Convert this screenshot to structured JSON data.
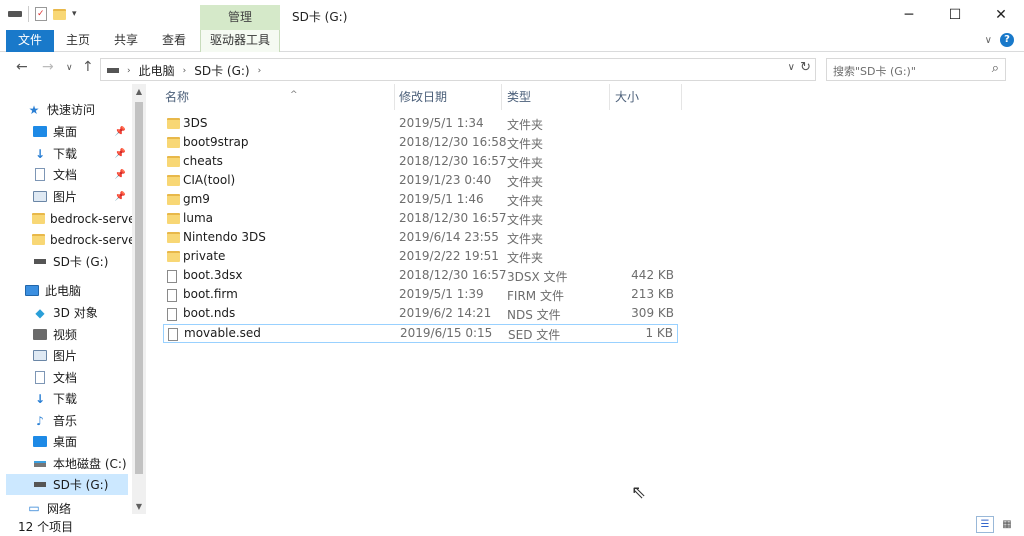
{
  "titlebar": {
    "context_tab": "管理",
    "window_title": "SD卡 (G:)",
    "minimize": "─",
    "maximize": "☐",
    "close": "✕"
  },
  "ribbon": {
    "tabs": [
      "文件",
      "主页",
      "共享",
      "查看",
      "驱动器工具"
    ],
    "expand": "∨",
    "help": "?"
  },
  "address": {
    "crumbs": [
      "此电脑",
      "SD卡 (G:)"
    ],
    "search_placeholder": "搜索\"SD卡 (G:)\""
  },
  "nav": {
    "quick_access": "快速访问",
    "quick_items": [
      "桌面",
      "下载",
      "文档",
      "图片",
      "bedrock-serve",
      "bedrock-serve",
      "SD卡 (G:)"
    ],
    "this_pc": "此电脑",
    "pc_items": [
      "3D 对象",
      "视频",
      "图片",
      "文档",
      "下载",
      "音乐",
      "桌面",
      "本地磁盘 (C:)",
      "SD卡 (G:)"
    ],
    "network": "网络"
  },
  "columns": {
    "name": "名称",
    "date": "修改日期",
    "type": "类型",
    "size": "大小"
  },
  "files": [
    {
      "name": "3DS",
      "date": "2019/5/1 1:34",
      "type": "文件夹",
      "size": "",
      "kind": "folder"
    },
    {
      "name": "boot9strap",
      "date": "2018/12/30 16:58",
      "type": "文件夹",
      "size": "",
      "kind": "folder"
    },
    {
      "name": "cheats",
      "date": "2018/12/30 16:57",
      "type": "文件夹",
      "size": "",
      "kind": "folder"
    },
    {
      "name": "CIA(tool)",
      "date": "2019/1/23 0:40",
      "type": "文件夹",
      "size": "",
      "kind": "folder"
    },
    {
      "name": "gm9",
      "date": "2019/5/1 1:46",
      "type": "文件夹",
      "size": "",
      "kind": "folder"
    },
    {
      "name": "luma",
      "date": "2018/12/30 16:57",
      "type": "文件夹",
      "size": "",
      "kind": "folder"
    },
    {
      "name": "Nintendo 3DS",
      "date": "2019/6/14 23:55",
      "type": "文件夹",
      "size": "",
      "kind": "folder"
    },
    {
      "name": "private",
      "date": "2019/2/22 19:51",
      "type": "文件夹",
      "size": "",
      "kind": "folder"
    },
    {
      "name": "boot.3dsx",
      "date": "2018/12/30 16:57",
      "type": "3DSX 文件",
      "size": "442 KB",
      "kind": "file"
    },
    {
      "name": "boot.firm",
      "date": "2019/5/1 1:39",
      "type": "FIRM 文件",
      "size": "213 KB",
      "kind": "file"
    },
    {
      "name": "boot.nds",
      "date": "2019/6/2 14:21",
      "type": "NDS 文件",
      "size": "309 KB",
      "kind": "file"
    },
    {
      "name": "movable.sed",
      "date": "2019/6/15 0:15",
      "type": "SED 文件",
      "size": "1 KB",
      "kind": "file"
    }
  ],
  "status": {
    "item_count": "12 个项目"
  },
  "colors": {
    "accent": "#1979ca",
    "context_tab": "#d5e9c9",
    "selection": "#cce8ff"
  }
}
